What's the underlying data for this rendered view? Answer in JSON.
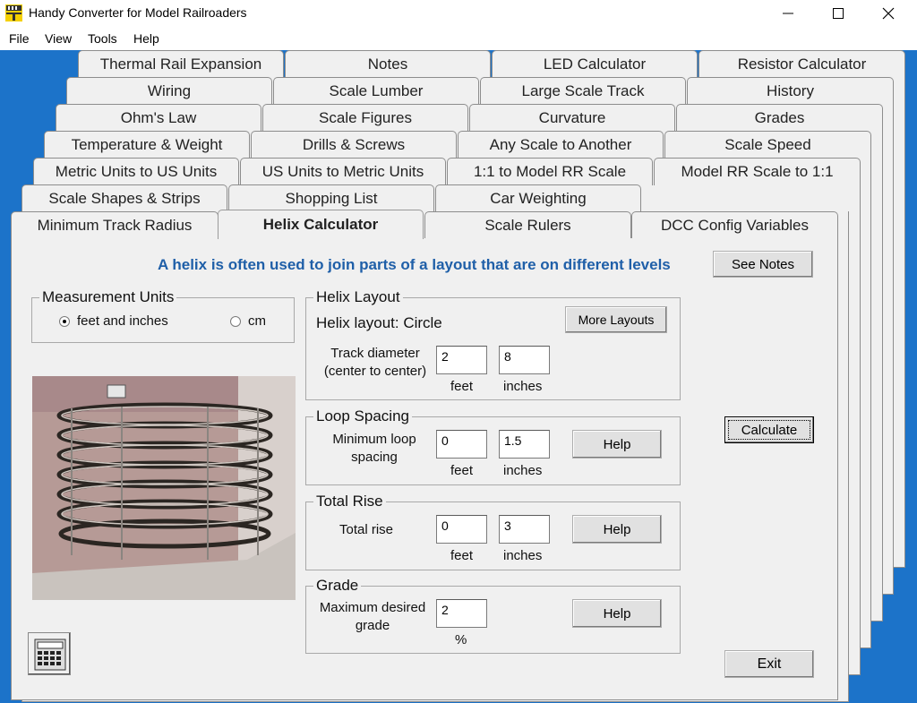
{
  "window": {
    "title": "Handy Converter for Model Railroaders",
    "minimize_glyph": "—",
    "maximize_glyph": "☐",
    "close_glyph": "✕"
  },
  "menu": [
    "File",
    "View",
    "Tools",
    "Help"
  ],
  "tabs": {
    "row1": [
      "Thermal Rail Expansion",
      "Notes",
      "LED Calculator",
      "Resistor Calculator"
    ],
    "row2": [
      "Wiring",
      "Scale Lumber",
      "Large Scale Track",
      "History"
    ],
    "row3": [
      "Ohm's Law",
      "Scale Figures",
      "Curvature",
      "Grades"
    ],
    "row4": [
      "Temperature & Weight",
      "Drills & Screws",
      "Any Scale to Another",
      "Scale Speed"
    ],
    "row5": [
      "Metric Units to US Units",
      "US Units to Metric Units",
      "1:1 to Model RR Scale",
      "Model RR Scale to 1:1"
    ],
    "row6": [
      "Scale Shapes & Strips",
      "Shopping List",
      "Car Weighting"
    ],
    "row7": [
      "Minimum Track Radius",
      "Helix Calculator",
      "Scale Rulers",
      "DCC Config Variables"
    ]
  },
  "panel": {
    "headline": "A helix is often used to join parts of a layout that are on different levels",
    "headline_color": "#1f5fa8",
    "see_notes": "See Notes",
    "calculate": "Calculate",
    "exit": "Exit",
    "units": {
      "title": "Measurement Units",
      "opt_feet": "feet and inches",
      "opt_cm": "cm",
      "selected": "feet and inches"
    },
    "layout": {
      "title": "Helix Layout",
      "current": "Helix layout: Circle",
      "more_layouts": "More Layouts",
      "diameter_label": "Track diameter (center to center)",
      "diameter_feet": "2",
      "diameter_inches": "8",
      "unit_feet": "feet",
      "unit_inches": "inches"
    },
    "loop": {
      "title": "Loop Spacing",
      "label": "Minimum loop spacing",
      "feet": "0",
      "inches": "1.5",
      "unit_feet": "feet",
      "unit_inches": "inches",
      "help": "Help"
    },
    "rise": {
      "title": "Total Rise",
      "label": "Total rise",
      "feet": "0",
      "inches": "3",
      "unit_feet": "feet",
      "unit_inches": "inches",
      "help": "Help"
    },
    "grade": {
      "title": "Grade",
      "label": "Maximum desired grade",
      "value": "2",
      "unit": "%",
      "help": "Help"
    },
    "icons": [
      "helix-photo",
      "calculator-icon",
      "app-icon"
    ]
  }
}
